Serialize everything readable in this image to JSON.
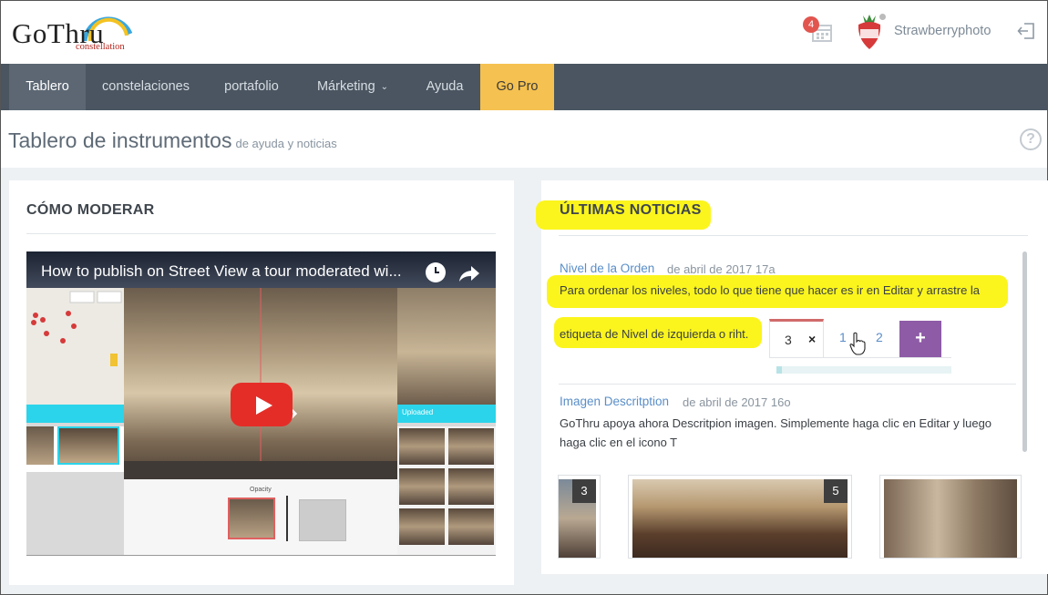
{
  "header": {
    "logo_main": "GoThru",
    "logo_sub": "constellation",
    "notifications_count": "4",
    "username": "Strawberryphoto"
  },
  "nav": {
    "items": [
      {
        "label": "Tablero",
        "active": true
      },
      {
        "label": "constelaciones"
      },
      {
        "label": "portafolio"
      },
      {
        "label": "Márketing",
        "has_dropdown": true
      },
      {
        "label": "Ayuda"
      },
      {
        "label": "Go Pro"
      }
    ]
  },
  "page": {
    "title": "Tablero de instrumentos",
    "subtitle": "de ayuda y noticias",
    "help_label": "?"
  },
  "moderate": {
    "title": "CÓMO MODERAR",
    "video": {
      "title": "How to publish on Street View a tour moderated wi...",
      "uploaded_label": "Uploaded",
      "opacity_label": "Opacity"
    }
  },
  "news": {
    "title": "ÚLTIMAS NOTICIAS",
    "items": [
      {
        "title": "Nivel de la Orden",
        "date": "de abril de 2017 17a",
        "text_line1": "Para ordenar los niveles, todo lo que tiene que hacer es ir en Editar y arrastre la",
        "text_line2": "etiqueta de Nivel de izquierda o riht.",
        "tabs": {
          "active": "3",
          "close": "×",
          "others": [
            "1",
            "2"
          ],
          "add": "+"
        }
      },
      {
        "title": "Imagen Descritption",
        "date": "de abril de 2017 16o",
        "text": "GoThru apoya ahora Descritpion imagen. Simplemente haga clic en Editar y luego haga clic en el icono T"
      }
    ],
    "photos": [
      "3",
      "5"
    ]
  },
  "colors": {
    "nav_bg": "#4a5561",
    "gopro": "#f5c150",
    "highlight": "#fbf51d",
    "link": "#5a8ec8",
    "add_button": "#8e5ba6"
  }
}
